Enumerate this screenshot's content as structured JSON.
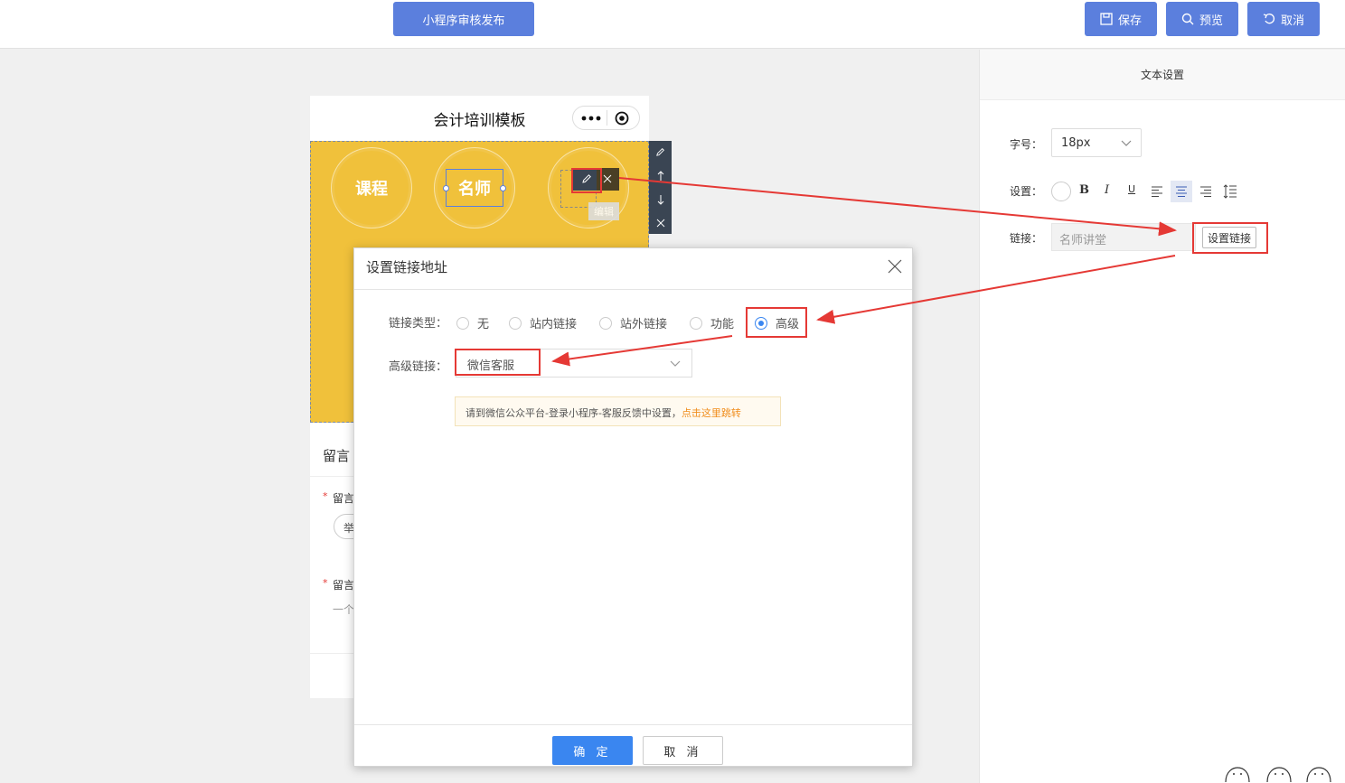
{
  "topbar": {
    "publish_label": "小程序审核发布",
    "save_label": "保存",
    "preview_label": "预览",
    "cancel_label": "取消"
  },
  "phone": {
    "title": "会计培训模板",
    "more_icon": "ellipsis-icon",
    "record_icon": "target-icon",
    "circles": [
      "课程",
      "名师"
    ],
    "edit_tip": "编辑"
  },
  "behind": {
    "section_heading_partial": "留言",
    "field1_partial": "留言",
    "field1_input_partial": "举",
    "field2_partial": "留言",
    "field2_text_partial": "一个"
  },
  "text_settings": {
    "title": "文本设置",
    "font_size_label": "字号：",
    "font_size_value": "18px",
    "settings_label": "设置：",
    "link_label": "链接：",
    "link_placeholder": "名师讲堂",
    "set_link_button": "设置链接"
  },
  "dialog": {
    "title": "设置链接地址",
    "link_type_label": "链接类型：",
    "options": [
      "无",
      "站内链接",
      "站外链接",
      "功能",
      "高级"
    ],
    "selected_option": "高级",
    "advanced_link_label": "高级链接：",
    "advanced_link_value": "微信客服",
    "notice_text": "请到微信公众平台-登录小程序-客服反馈中设置，",
    "notice_link": "点击这里跳转",
    "ok_label": "确 定",
    "cancel_label": "取 消"
  },
  "colors": {
    "primary": "#5b7fdd",
    "dialog_primary": "#3a86f0",
    "yellow": "#f0c13b",
    "annotation_red": "#e53935",
    "notice_orange": "#f08c1a"
  }
}
